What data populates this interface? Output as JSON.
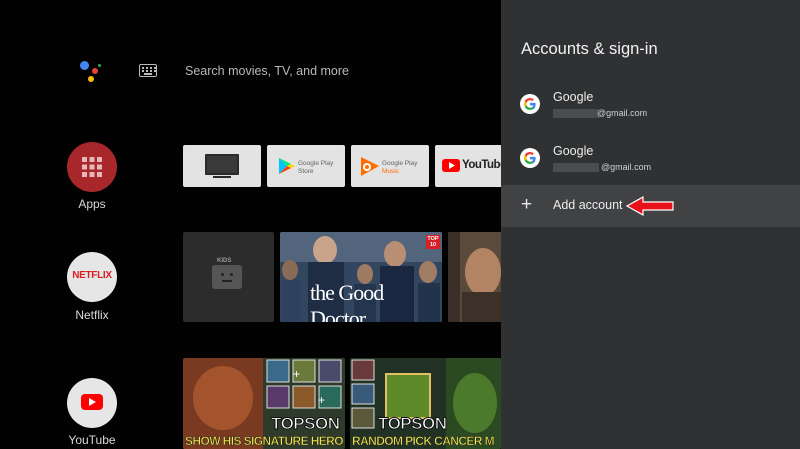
{
  "search": {
    "placeholder": "Search movies, TV, and more"
  },
  "sidebar": {
    "items": [
      {
        "label": "Apps"
      },
      {
        "label": "Netflix",
        "logo": "NETFLIX"
      },
      {
        "label": "YouTube"
      }
    ]
  },
  "app_row": [
    {
      "name": "tv-tile"
    },
    {
      "line1": "Google Play",
      "line2": "Store"
    },
    {
      "line1": "Google Play",
      "line2": "Music"
    },
    {
      "label": "YouTube"
    }
  ],
  "content_row": [
    {
      "badge": "KIDS"
    },
    {
      "title": "the Good Doctor",
      "badge": "TOP 10"
    },
    {
      "name": "drama-thumbnail"
    }
  ],
  "video_row": [
    {
      "caption": "SHOW HIS SIGNATURE HERO",
      "overlay": "TOPSON"
    },
    {
      "caption": "RANDOM PICK CANCER M",
      "overlay": "TOPSON"
    }
  ],
  "panel": {
    "title": "Accounts & sign-in",
    "accounts": [
      {
        "name": "Google",
        "email": "@gmail.com"
      },
      {
        "name": "Google",
        "email": "@gmail.com"
      }
    ],
    "add_account": "Add account"
  },
  "colors": {
    "panel_bg": "#2f3133",
    "highlight_row": "#404244",
    "arrow": "#e8101a",
    "apps_circle": "#a8272a",
    "youtube_red": "#ff0000"
  }
}
